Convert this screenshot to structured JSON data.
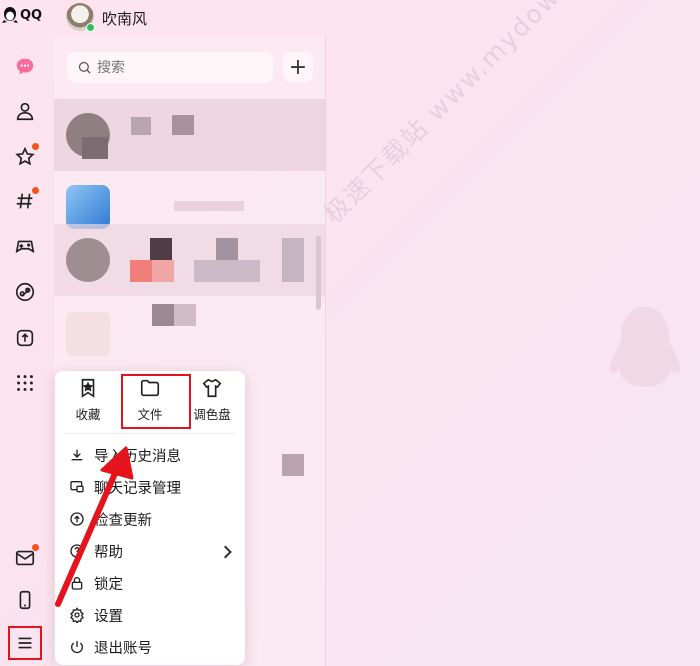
{
  "topbar": {
    "logo_text": "QQ",
    "username": "吹南风"
  },
  "nav": {
    "items": [
      {
        "icon": "chat-bubble-icon",
        "badge": false
      },
      {
        "icon": "contacts-icon",
        "badge": false
      },
      {
        "icon": "star-icon",
        "badge": true
      },
      {
        "icon": "hashtag-icon",
        "badge": true
      },
      {
        "icon": "game-icon",
        "badge": false
      },
      {
        "icon": "planet-icon",
        "badge": false
      },
      {
        "icon": "upload-icon",
        "badge": false
      },
      {
        "icon": "apps-grid-icon",
        "badge": false
      }
    ],
    "bottom": [
      {
        "icon": "mail-icon",
        "badge": true
      },
      {
        "icon": "phone-icon",
        "badge": false
      },
      {
        "icon": "menu-icon",
        "badge": false
      }
    ]
  },
  "search": {
    "placeholder": "搜索",
    "add_label": "+"
  },
  "popup": {
    "tools": [
      {
        "icon": "collect-icon",
        "label": "收藏"
      },
      {
        "icon": "folder-icon",
        "label": "文件"
      },
      {
        "icon": "palette-icon",
        "label": "调色盘"
      }
    ],
    "items": [
      {
        "icon": "download-icon",
        "label": "导入历史消息"
      },
      {
        "icon": "chat-record-icon",
        "label": "聊天记录管理"
      },
      {
        "icon": "update-icon",
        "label": "检查更新"
      },
      {
        "icon": "help-icon",
        "label": "帮助",
        "has_submenu": true
      },
      {
        "icon": "lock-icon",
        "label": "锁定"
      },
      {
        "icon": "settings-icon",
        "label": "设置"
      },
      {
        "icon": "logout-icon",
        "label": "退出账号"
      }
    ]
  },
  "watermark": "极速下载站 www.mydown.com",
  "colors": {
    "accent_pink": "#f96b9b",
    "annotation_red": "#e5141c",
    "badge": "#f4511e"
  }
}
